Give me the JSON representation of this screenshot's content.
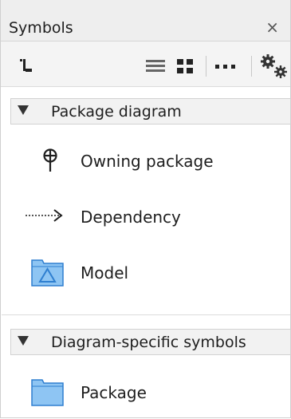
{
  "panel": {
    "title": "Symbols",
    "close_glyph": "×"
  },
  "toolbar": {
    "buttons": [
      {
        "name": "layout-icon"
      },
      {
        "name": "list-view-icon"
      },
      {
        "name": "grid-view-icon"
      },
      {
        "name": "more-icon"
      },
      {
        "name": "settings-icon"
      }
    ]
  },
  "groups": [
    {
      "label": "Package diagram",
      "items": [
        {
          "label": "Owning package",
          "icon": "owning-package-icon"
        },
        {
          "label": "Dependency",
          "icon": "dependency-arrow-icon"
        },
        {
          "label": "Model",
          "icon": "model-folder-icon"
        }
      ]
    },
    {
      "label": "Diagram-specific symbols",
      "items": [
        {
          "label": "Package",
          "icon": "package-folder-icon"
        }
      ]
    }
  ],
  "colors": {
    "folder_fill": "#8ec5f3",
    "folder_stroke": "#2f7fd0",
    "icon_dark": "#1e1e1e"
  }
}
